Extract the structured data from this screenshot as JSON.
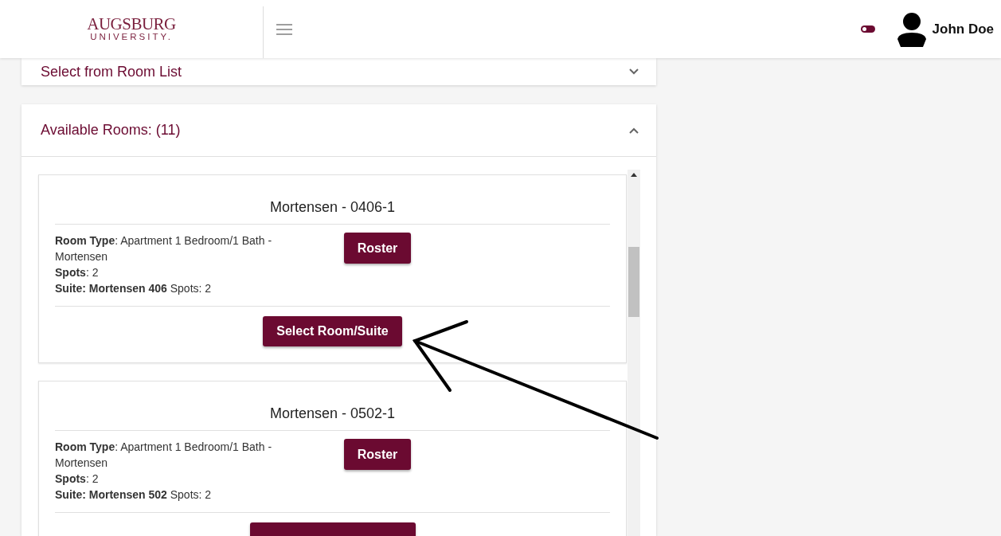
{
  "header": {
    "logo_main": "AUGSBURG",
    "logo_sub": "UNIVERSITY.",
    "theme_toggle": {
      "on": false
    },
    "user_name": "John Doe"
  },
  "panels": [
    {
      "title": "Select from Room List",
      "expanded": false
    },
    {
      "title": "Available Rooms: (11)",
      "expanded": true,
      "rooms": [
        {
          "title": "Mortensen - 0406-1",
          "details": [
            "**Room Type**: Apartment 1 Bedroom/1 Bath - Mortensen",
            "**Spots**: 2",
            "**Suite: Mortensen 406** Spots: 2"
          ],
          "roster_label": "Roster",
          "select_label": "Select Room/Suite"
        },
        {
          "title": "Mortensen - 0502-1",
          "details": [
            "**Room Type**: Apartment 1 Bedroom/1 Bath - Mortensen",
            "**Spots**: 2",
            "**Suite: Mortensen 502** Spots: 2"
          ],
          "roster_label": "Roster"
        }
      ]
    }
  ]
}
